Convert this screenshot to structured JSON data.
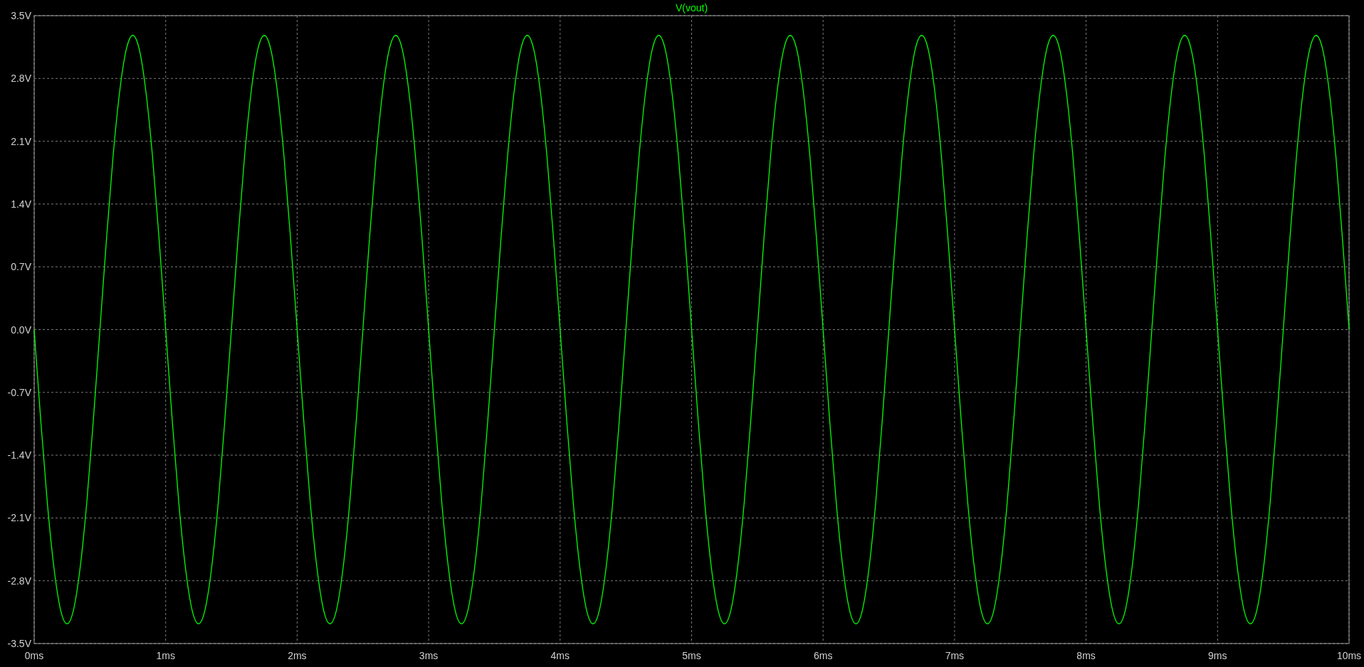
{
  "plot": {
    "chart_data": {
      "type": "line",
      "grid": true,
      "xlim": [
        0,
        10
      ],
      "ylim": [
        -3.5,
        3.5
      ],
      "xticks": [
        {
          "value": 0,
          "label": "0ms"
        },
        {
          "value": 1,
          "label": "1ms"
        },
        {
          "value": 2,
          "label": "2ms"
        },
        {
          "value": 3,
          "label": "3ms"
        },
        {
          "value": 4,
          "label": "4ms"
        },
        {
          "value": 5,
          "label": "5ms"
        },
        {
          "value": 6,
          "label": "6ms"
        },
        {
          "value": 7,
          "label": "7ms"
        },
        {
          "value": 8,
          "label": "8ms"
        },
        {
          "value": 9,
          "label": "9ms"
        },
        {
          "value": 10,
          "label": "10ms"
        }
      ],
      "yticks": [
        {
          "value": 3.5,
          "label": "3.5V"
        },
        {
          "value": 2.8,
          "label": "2.8V"
        },
        {
          "value": 2.1,
          "label": "2.1V"
        },
        {
          "value": 1.4,
          "label": "1.4V"
        },
        {
          "value": 0.7,
          "label": "0.7V"
        },
        {
          "value": 0,
          "label": "0.0V"
        },
        {
          "value": -0.7,
          "label": "-0.7V"
        },
        {
          "value": -1.4,
          "label": "-1.4V"
        },
        {
          "value": -2.1,
          "label": "-2.1V"
        },
        {
          "value": -2.8,
          "label": "-2.8V"
        },
        {
          "value": -3.5,
          "label": "-3.5V"
        }
      ],
      "x": [
        0,
        0.05,
        0.1,
        0.15,
        0.2,
        0.25,
        0.3,
        0.35,
        0.4,
        0.45,
        0.5,
        0.55,
        0.6,
        0.65,
        0.7,
        0.75,
        0.8,
        0.85,
        0.9,
        0.95,
        1,
        1.05,
        1.1,
        1.15,
        1.2,
        1.25,
        1.3,
        1.35,
        1.4,
        1.45,
        1.5,
        1.55,
        1.6,
        1.65,
        1.7,
        1.75,
        1.8,
        1.85,
        1.9,
        1.95,
        2,
        2.05,
        2.1,
        2.15,
        2.2,
        2.25,
        2.3,
        2.35,
        2.4,
        2.45,
        2.5,
        2.55,
        2.6,
        2.65,
        2.7,
        2.75,
        2.8,
        2.85,
        2.9,
        2.95,
        3,
        3.05,
        3.1,
        3.15,
        3.2,
        3.25,
        3.3,
        3.35,
        3.4,
        3.45,
        3.5,
        3.55,
        3.6,
        3.65,
        3.7,
        3.75,
        3.8,
        3.85,
        3.9,
        3.95,
        4,
        4.05,
        4.1,
        4.15,
        4.2,
        4.25,
        4.3,
        4.35,
        4.4,
        4.45,
        4.5,
        4.55,
        4.6,
        4.65,
        4.7,
        4.75,
        4.8,
        4.85,
        4.9,
        4.95,
        5,
        5.05,
        5.1,
        5.15,
        5.2,
        5.25,
        5.3,
        5.35,
        5.4,
        5.45,
        5.5,
        5.55,
        5.6,
        5.65,
        5.7,
        5.75,
        5.8,
        5.85,
        5.9,
        5.95,
        6,
        6.05,
        6.1,
        6.15,
        6.2,
        6.25,
        6.3,
        6.35,
        6.4,
        6.45,
        6.5,
        6.55,
        6.6,
        6.65,
        6.7,
        6.75,
        6.8,
        6.85,
        6.9,
        6.95,
        7,
        7.05,
        7.1,
        7.15,
        7.2,
        7.25,
        7.3,
        7.35,
        7.4,
        7.45,
        7.5,
        7.55,
        7.6,
        7.65,
        7.7,
        7.75,
        7.8,
        7.85,
        7.9,
        7.95,
        8,
        8.05,
        8.1,
        8.15,
        8.2,
        8.25,
        8.3,
        8.35,
        8.4,
        8.45,
        8.5,
        8.55,
        8.6,
        8.65,
        8.7,
        8.75,
        8.8,
        8.85,
        8.9,
        8.95,
        9,
        9.05,
        9.1,
        9.15,
        9.2,
        9.25,
        9.3,
        9.35,
        9.4,
        9.45,
        9.5,
        9.55,
        9.6,
        9.65,
        9.7,
        9.75,
        9.8,
        9.85,
        9.9,
        9.95,
        10
      ],
      "series": [
        {
          "name": "V(vout)",
          "color": "#00ff00",
          "values": [
            0,
            -1.01,
            -1.93,
            -2.65,
            -3.12,
            -3.28,
            -3.12,
            -2.65,
            -1.93,
            -1.01,
            0,
            1.01,
            1.93,
            2.65,
            3.12,
            3.28,
            3.12,
            2.65,
            1.93,
            1.01,
            0,
            -1.01,
            -1.93,
            -2.65,
            -3.12,
            -3.28,
            -3.12,
            -2.65,
            -1.93,
            -1.01,
            0,
            1.01,
            1.93,
            2.65,
            3.12,
            3.28,
            3.12,
            2.65,
            1.93,
            1.01,
            0,
            -1.01,
            -1.93,
            -2.65,
            -3.12,
            -3.28,
            -3.12,
            -2.65,
            -1.93,
            -1.01,
            0,
            1.01,
            1.93,
            2.65,
            3.12,
            3.28,
            3.12,
            2.65,
            1.93,
            1.01,
            0,
            -1.01,
            -1.93,
            -2.65,
            -3.12,
            -3.28,
            -3.12,
            -2.65,
            -1.93,
            -1.01,
            0,
            1.01,
            1.93,
            2.65,
            3.12,
            3.28,
            3.12,
            2.65,
            1.93,
            1.01,
            0,
            -1.01,
            -1.93,
            -2.65,
            -3.12,
            -3.28,
            -3.12,
            -2.65,
            -1.93,
            -1.01,
            0,
            1.01,
            1.93,
            2.65,
            3.12,
            3.28,
            3.12,
            2.65,
            1.93,
            1.01,
            0,
            -1.01,
            -1.93,
            -2.65,
            -3.12,
            -3.28,
            -3.12,
            -2.65,
            -1.93,
            -1.01,
            0,
            1.01,
            1.93,
            2.65,
            3.12,
            3.28,
            3.12,
            2.65,
            1.93,
            1.01,
            0,
            -1.01,
            -1.93,
            -2.65,
            -3.12,
            -3.28,
            -3.12,
            -2.65,
            -1.93,
            -1.01,
            0,
            1.01,
            1.93,
            2.65,
            3.12,
            3.28,
            3.12,
            2.65,
            1.93,
            1.01,
            0,
            -1.01,
            -1.93,
            -2.65,
            -3.12,
            -3.28,
            -3.12,
            -2.65,
            -1.93,
            -1.01,
            0,
            1.01,
            1.93,
            2.65,
            3.12,
            3.28,
            3.12,
            2.65,
            1.93,
            1.01,
            0,
            -1.01,
            -1.93,
            -2.65,
            -3.12,
            -3.28,
            -3.12,
            -2.65,
            -1.93,
            -1.01,
            0,
            1.01,
            1.93,
            2.65,
            3.12,
            3.28,
            3.12,
            2.65,
            1.93,
            1.01,
            0,
            -1.01,
            -1.93,
            -2.65,
            -3.12,
            -3.28,
            -3.12,
            -2.65,
            -1.93,
            -1.01,
            0,
            1.01,
            1.93,
            2.65,
            3.12,
            3.28,
            3.12,
            2.65,
            1.93,
            1.01,
            0
          ]
        }
      ]
    }
  }
}
